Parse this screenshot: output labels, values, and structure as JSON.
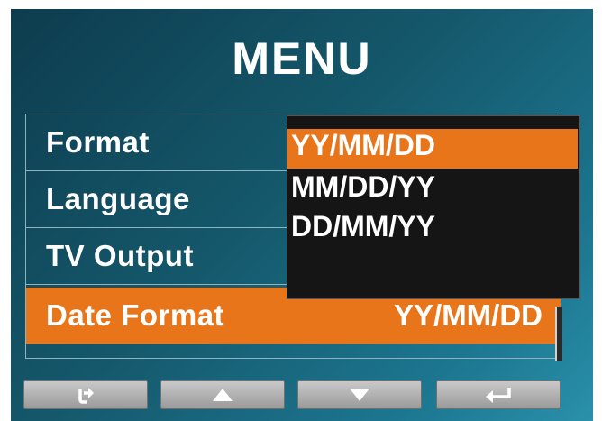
{
  "header": {
    "title": "MENU"
  },
  "menu": {
    "items": [
      {
        "label": "Format",
        "value": ""
      },
      {
        "label": "Language",
        "value": ""
      },
      {
        "label": "TV Output",
        "value": ""
      },
      {
        "label": "Date Format",
        "value": "YY/MM/DD"
      }
    ],
    "selected_index": 3
  },
  "dropdown": {
    "options": [
      "YY/MM/DD",
      "MM/DD/YY",
      "DD/MM/YY"
    ],
    "selected_index": 0
  },
  "nav_buttons": [
    {
      "icon": "return-icon"
    },
    {
      "icon": "up-arrow-icon"
    },
    {
      "icon": "down-arrow-icon"
    },
    {
      "icon": "enter-icon"
    }
  ],
  "colors": {
    "background": "#15586b",
    "highlight": "#e8751a",
    "dropdown_bg": "#151515",
    "text": "#ffffff",
    "button": "#b5b5b5"
  }
}
